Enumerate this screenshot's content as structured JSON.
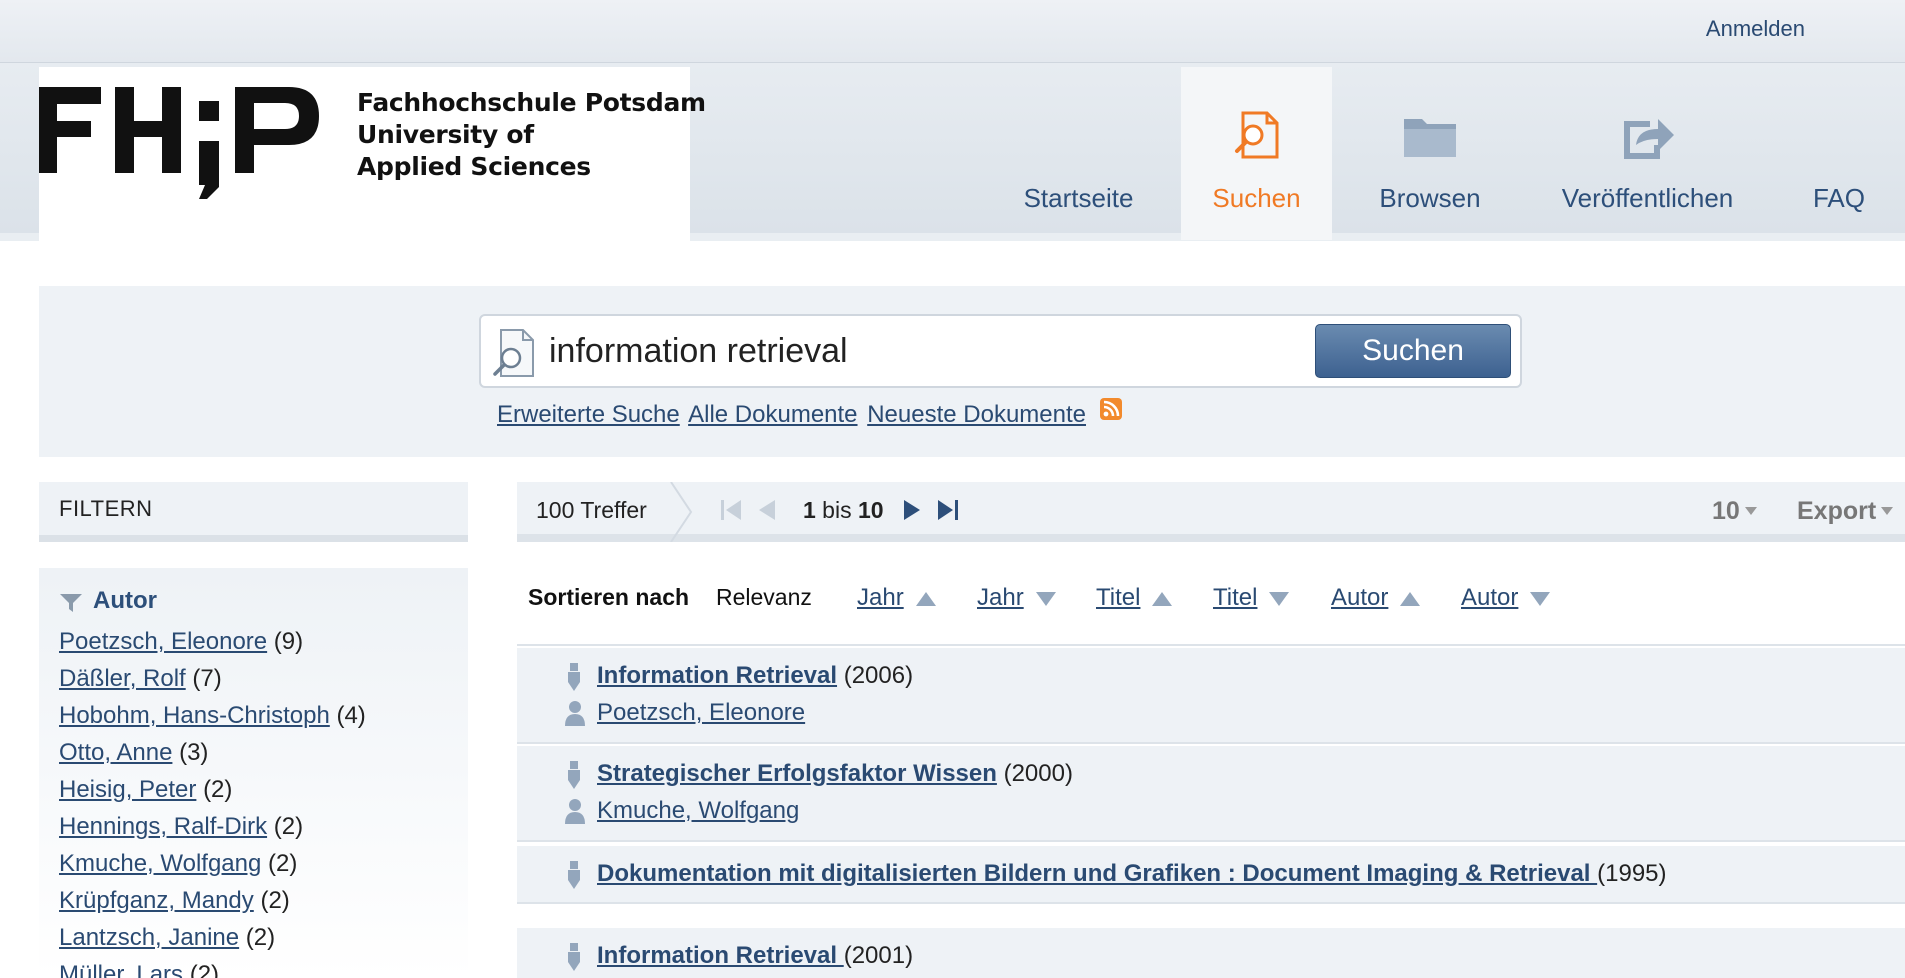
{
  "topbar": {
    "login_label": "Anmelden"
  },
  "logo": {
    "mark_text": "FH;P",
    "line1": "Fachhochschule Potsdam",
    "line2": "University of",
    "line3": "Applied Sciences"
  },
  "nav": {
    "items": [
      {
        "label": "Startseite"
      },
      {
        "label": "Suchen",
        "active": true,
        "icon": "search-document-icon"
      },
      {
        "label": "Browsen",
        "icon": "folder-icon"
      },
      {
        "label": "Veröffentlichen",
        "icon": "share-icon"
      },
      {
        "label": "FAQ"
      }
    ]
  },
  "search": {
    "query": "information retrieval",
    "button_label": "Suchen",
    "links": [
      "Erweiterte Suche",
      "Alle Dokumente",
      "Neueste Dokumente"
    ]
  },
  "filter": {
    "title": "FILTERN",
    "facet_title": "Autor",
    "items": [
      {
        "name": "Poetzsch, Eleonore",
        "count": "(9)"
      },
      {
        "name": "Däßler, Rolf",
        "count": "(7)"
      },
      {
        "name": "Hobohm, Hans-Christoph",
        "count": "(4)"
      },
      {
        "name": "Otto, Anne",
        "count": "(3)"
      },
      {
        "name": "Heisig, Peter",
        "count": "(2)"
      },
      {
        "name": "Hennings, Ralf-Dirk",
        "count": "(2)"
      },
      {
        "name": "Kmuche, Wolfgang",
        "count": "(2)"
      },
      {
        "name": "Krüpfganz, Mandy",
        "count": "(2)"
      },
      {
        "name": "Lantzsch, Janine",
        "count": "(2)"
      },
      {
        "name": "Müller, Lars",
        "count": "(2)"
      }
    ]
  },
  "results_bar": {
    "hits": "100 Treffer",
    "range_from": "1",
    "range_sep": " bis ",
    "range_to": "10",
    "per_page": "10",
    "export_label": "Export"
  },
  "sort": {
    "label": "Sortieren nach",
    "relevance": "Relevanz",
    "options": [
      {
        "label": "Jahr",
        "dir": "asc"
      },
      {
        "label": "Jahr",
        "dir": "desc"
      },
      {
        "label": "Titel",
        "dir": "asc"
      },
      {
        "label": "Titel",
        "dir": "desc"
      },
      {
        "label": "Autor",
        "dir": "asc"
      },
      {
        "label": "Autor",
        "dir": "desc"
      }
    ]
  },
  "results": [
    {
      "title": "Information Retrieval",
      "year": "(2006)",
      "author": "Poetzsch, Eleonore"
    },
    {
      "title": "Strategischer Erfolgsfaktor Wissen",
      "year": "(2000)",
      "author": "Kmuche, Wolfgang"
    },
    {
      "title": "Dokumentation mit digitalisierten Bildern und Grafiken : Document Imaging & Retrieval ",
      "year": "(1995)",
      "author": ""
    },
    {
      "title": "Information Retrieval ",
      "year": "(2001)",
      "author": ""
    }
  ],
  "colors": {
    "link": "#2a4a72",
    "active_nav": "#f07a25",
    "panel": "#eef2f6",
    "button": "#3d6190"
  }
}
